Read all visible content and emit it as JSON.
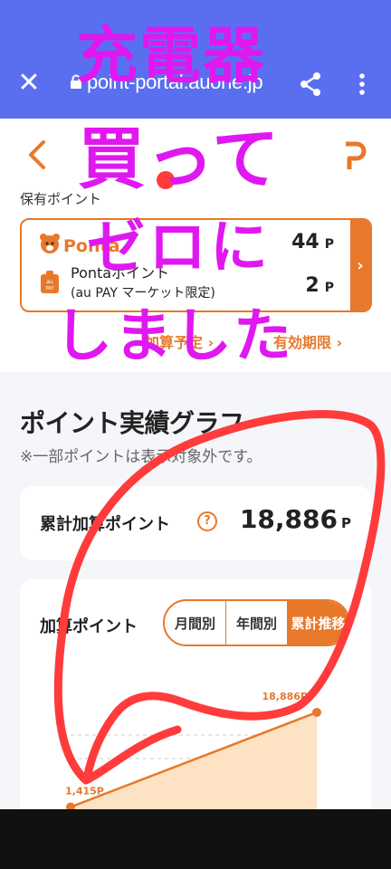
{
  "browser": {
    "url": "point-portal.auone.jp",
    "icons": [
      "close-icon",
      "lock-icon",
      "share-icon",
      "more-vert-icon"
    ]
  },
  "header": {
    "holding_label": "保有ポイント",
    "ponta": {
      "logo_text": "Ponta",
      "points": "44",
      "unit": "P"
    },
    "aupay": {
      "name": "Pontaポイント",
      "sub": "(au PAY マーケット限定)",
      "points": "2",
      "unit": "P"
    },
    "links": {
      "scheduled": "加算予定 ›",
      "expiry": "有効期限 ›"
    }
  },
  "graph": {
    "title": "ポイント実績グラフ",
    "note": "※一部ポイントは表示対象外です。",
    "total_label": "累計加算ポイント",
    "help": "?",
    "total_value": "18,886",
    "total_unit": "P",
    "chart_label": "加算ポイント",
    "tabs": [
      "月間別",
      "年間別",
      "累計推移"
    ],
    "selected_tab": "累計推移"
  },
  "chart_data": {
    "type": "area",
    "x": [
      "start",
      "end"
    ],
    "values": [
      1415,
      18886
    ],
    "labels": [
      "1,415P",
      "18,886P"
    ],
    "color": "#e8782a",
    "fill": "#fde3c4"
  },
  "overlay": {
    "line1": "充電器",
    "line2": "買って",
    "line3": "ゼロに",
    "line4": "しました",
    "colors": {
      "text": "#e018f0",
      "scribble": "#ff3b3b"
    }
  },
  "colors": {
    "accent": "#e8782a",
    "browser": "#5a6ff0"
  }
}
